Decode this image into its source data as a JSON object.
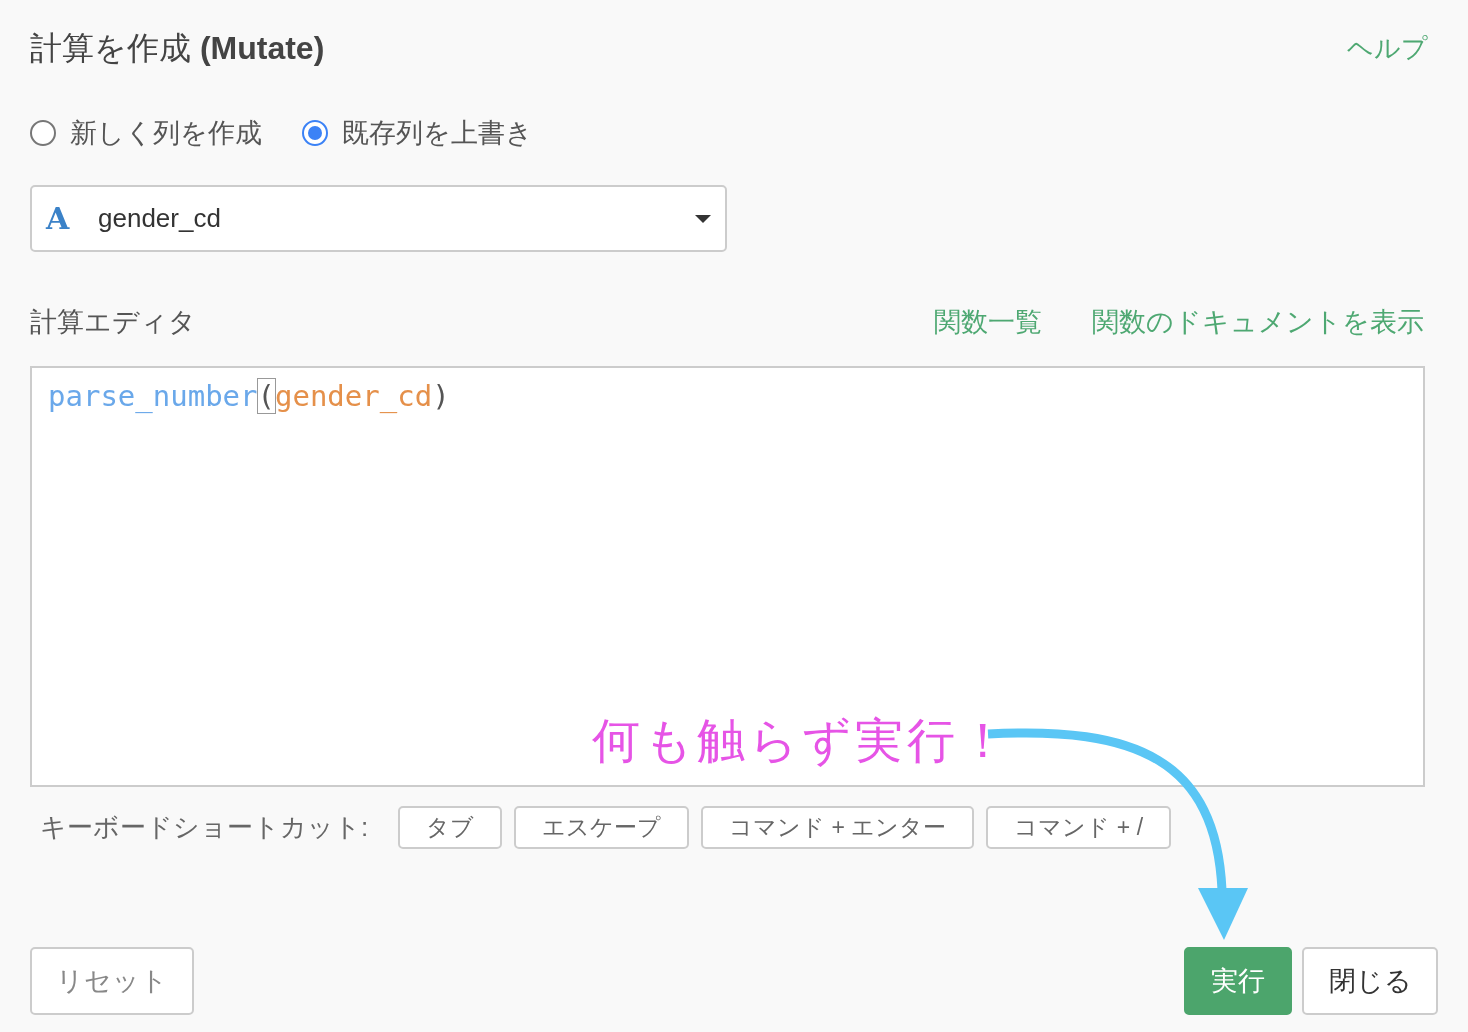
{
  "dialog": {
    "title": "計算を作成 **(Mutate)**",
    "help_link": "ヘルプ"
  },
  "mode_options": [
    {
      "label": "新しく列を作成",
      "selected": false
    },
    {
      "label": "既存列を上書き",
      "selected": true
    }
  ],
  "column_select": {
    "type_icon": "A",
    "value": "gender_cd"
  },
  "editor": {
    "label": "計算エディタ",
    "links": [
      "関数一覧",
      "関数のドキュメントを表示"
    ],
    "tokens": [
      {
        "text": "parse_number",
        "kind": "function",
        "cursor": false
      },
      {
        "text": "(",
        "kind": "paren",
        "cursor": true
      },
      {
        "text": "gender_cd",
        "kind": "column",
        "cursor": false
      },
      {
        "text": ")",
        "kind": "paren",
        "cursor": false
      }
    ]
  },
  "shortcuts": {
    "label": "キーボードショートカット:",
    "keys": [
      "タブ",
      "エスケープ",
      "コマンド + エンター",
      "コマンド + /"
    ]
  },
  "annotation": {
    "text": "何も触らず実行！"
  },
  "footer_buttons": [
    {
      "label": "リセット",
      "kind": "secondary"
    },
    {
      "label": "実行",
      "kind": "primary"
    },
    {
      "label": "閉じる",
      "kind": "default"
    }
  ]
}
